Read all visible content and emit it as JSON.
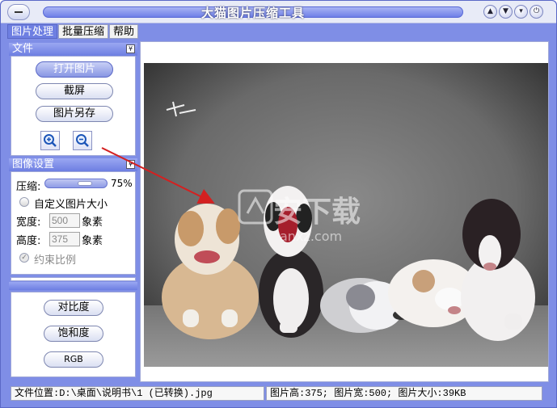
{
  "window": {
    "title": "大猫图片压缩工具",
    "controls": [
      "⌃",
      "⌄",
      "⌄",
      "⏻"
    ]
  },
  "menu": {
    "items": [
      "图片处理",
      "批量压缩",
      "帮助"
    ]
  },
  "file_section": {
    "header": "文件",
    "open_image": "打开图片",
    "screenshot": "截屏",
    "save_as": "图片另存"
  },
  "image_settings": {
    "header": "图像设置",
    "compress_label": "压缩:",
    "compress_value": "75%",
    "custom_size_label": "自定义图片大小",
    "width_label": "宽度:",
    "width_value": "500",
    "width_unit": "象素",
    "height_label": "高度:",
    "height_value": "375",
    "height_unit": "象素",
    "keep_ratio_label": "约束比例"
  },
  "adjust_section": {
    "contrast": "对比度",
    "saturation": "饱和度",
    "rgb": "RGB"
  },
  "preview": {
    "watermark_text": "安下载",
    "watermark_sub": "anxz.com"
  },
  "status": {
    "file_location": "文件位置:D:\\桌面\\说明书\\1 (已转换).jpg",
    "image_info": "图片高:375;  图片宽:500;  图片大小:39KB"
  },
  "colors": {
    "frame": "#7f8ee6",
    "accent": "#6e7fe2",
    "arrow": "#d42020"
  }
}
